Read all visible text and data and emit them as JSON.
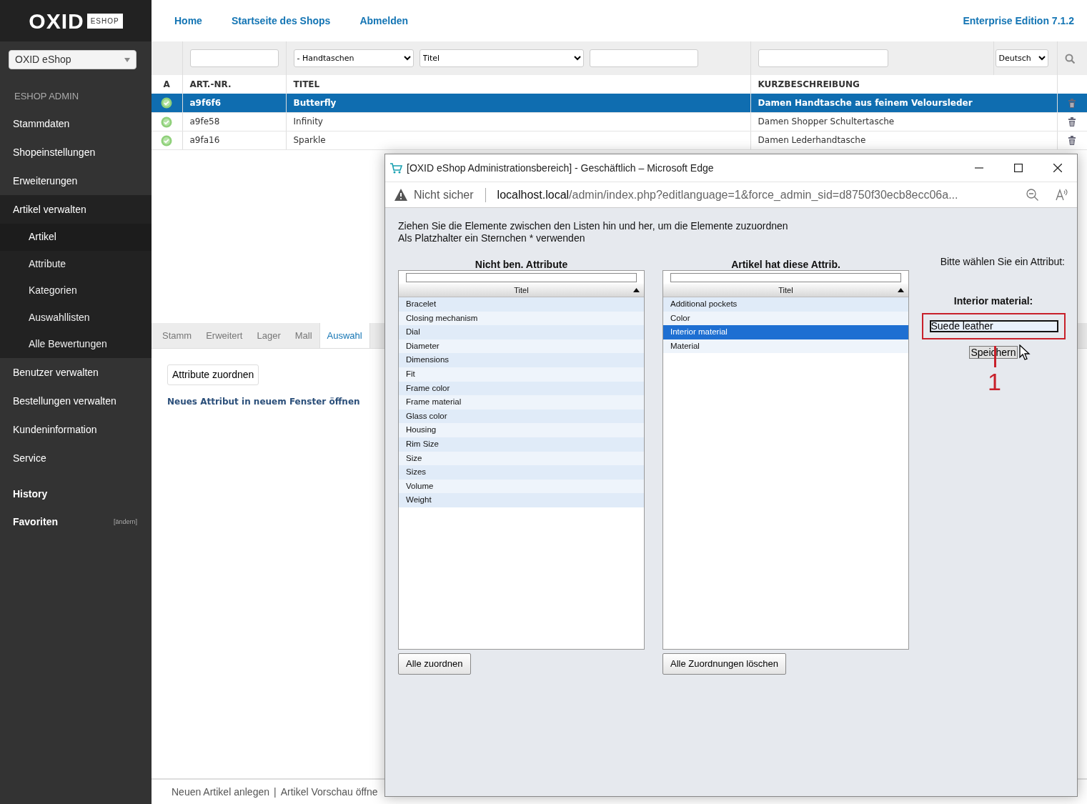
{
  "sidebar": {
    "logo": {
      "text": "OXID",
      "badge": "ESHOP"
    },
    "shop_select": "OXID eShop",
    "section_label": "ESHOP ADMIN",
    "items": [
      {
        "label": "Stammdaten",
        "expanded": false
      },
      {
        "label": "Shopeinstellungen",
        "expanded": false
      },
      {
        "label": "Erweiterungen",
        "expanded": false
      },
      {
        "label": "Artikel verwalten",
        "expanded": true,
        "children": [
          {
            "label": "Artikel",
            "selected": true
          },
          {
            "label": "Attribute",
            "selected": false
          },
          {
            "label": "Kategorien",
            "selected": false
          },
          {
            "label": "Auswahllisten",
            "selected": false
          },
          {
            "label": "Alle Bewertungen",
            "selected": false
          }
        ]
      },
      {
        "label": "Benutzer verwalten",
        "expanded": false
      },
      {
        "label": "Bestellungen verwalten",
        "expanded": false
      },
      {
        "label": "Kundeninformation",
        "expanded": false
      },
      {
        "label": "Service",
        "expanded": false
      }
    ],
    "bottom_items": [
      {
        "label": "History"
      },
      {
        "label": "Favoriten",
        "action": "[ändern]"
      }
    ]
  },
  "header": {
    "links": [
      "Home",
      "Startseite des Shops",
      "Abmelden"
    ],
    "edition": "Enterprise Edition 7.1.2"
  },
  "filters": {
    "category_select": "- Handtaschen",
    "field_select": "Titel",
    "language_select": "Deutsch"
  },
  "table": {
    "columns": [
      "A",
      "ART.-NR.",
      "TITEL",
      "KURZBESCHREIBUNG"
    ],
    "rows": [
      {
        "active": true,
        "selected": true,
        "artnum": "a9f6f6",
        "title": "Butterfly",
        "description": "Damen Handtasche aus feinem Veloursleder"
      },
      {
        "active": true,
        "selected": false,
        "artnum": "a9fe58",
        "title": "Infinity",
        "description": "Damen Shopper Schultertasche"
      },
      {
        "active": true,
        "selected": false,
        "artnum": "a9fa16",
        "title": "Sparkle",
        "description": "Damen Lederhandtasche"
      }
    ]
  },
  "tabs": [
    {
      "label": "Stamm",
      "selected": false
    },
    {
      "label": "Erweitert",
      "selected": false
    },
    {
      "label": "Lager",
      "selected": false
    },
    {
      "label": "Mall",
      "selected": false
    },
    {
      "label": "Auswahl",
      "selected": true
    }
  ],
  "assign_button": "Attribute zuordnen",
  "new_window_link": "Neues Attribut in neuem Fenster öffnen",
  "footer_links": [
    "Neuen Artikel anlegen",
    "Artikel Vorschau öffne"
  ],
  "footer_separator": "|",
  "popup": {
    "title": "[OXID eShop Administrationsbereich] - Geschäftlich – Microsoft Edge",
    "address": {
      "warning": "Nicht sicher",
      "host": "localhost.local",
      "path": "/admin/index.php?editlanguage=1&force_admin_sid=d8750f30ecb8ecc06a..."
    },
    "instructions": [
      "Ziehen Sie die Elemente zwischen den Listen hin und her, um die Elemente zuzuordnen",
      "Als Platzhalter ein Sternchen * verwenden"
    ],
    "lists": [
      {
        "heading": "Nicht ben. Attribute",
        "column": "Titel",
        "button": "Alle zuordnen",
        "items": [
          {
            "label": "Bracelet",
            "selected": false
          },
          {
            "label": "Closing mechanism",
            "selected": false
          },
          {
            "label": "Dial",
            "selected": false
          },
          {
            "label": "Diameter",
            "selected": false
          },
          {
            "label": "Dimensions",
            "selected": false
          },
          {
            "label": "Fit",
            "selected": false
          },
          {
            "label": "Frame color",
            "selected": false
          },
          {
            "label": "Frame material",
            "selected": false
          },
          {
            "label": "Glass color",
            "selected": false
          },
          {
            "label": "Housing",
            "selected": false
          },
          {
            "label": "Rim Size",
            "selected": false
          },
          {
            "label": "Size",
            "selected": false
          },
          {
            "label": "Sizes",
            "selected": false
          },
          {
            "label": "Volume",
            "selected": false
          },
          {
            "label": "Weight",
            "selected": false
          }
        ]
      },
      {
        "heading": "Artikel hat diese Attrib.",
        "column": "Titel",
        "button": "Alle Zuordnungen löschen",
        "items": [
          {
            "label": "Additional pockets",
            "selected": false
          },
          {
            "label": "Color",
            "selected": false
          },
          {
            "label": "Interior material",
            "selected": true
          },
          {
            "label": "Material",
            "selected": false
          }
        ]
      }
    ],
    "editor": {
      "prompt": "Bitte wählen Sie ein Attribut:",
      "attribute_label": "Interior material:",
      "value": "Suede leather",
      "save": "Speichern"
    }
  },
  "annotation": {
    "label": "1"
  }
}
